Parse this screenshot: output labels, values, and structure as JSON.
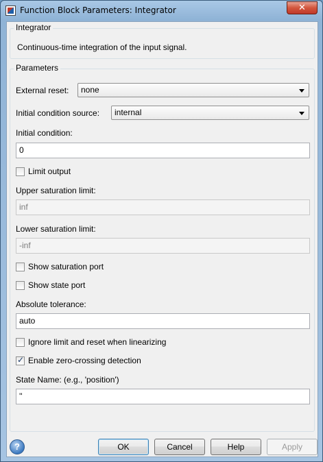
{
  "window": {
    "title": "Function Block Parameters: Integrator",
    "close_label": "✕"
  },
  "block": {
    "group_title": "Integrator",
    "description": "Continuous-time integration of the input signal."
  },
  "params": {
    "group_title": "Parameters",
    "external_reset": {
      "label": "External reset:",
      "value": "none"
    },
    "ic_source": {
      "label": "Initial condition source:",
      "value": "internal"
    },
    "initial_condition": {
      "label": "Initial condition:",
      "value": "0"
    },
    "limit_output": {
      "label": "Limit output",
      "checked": false
    },
    "upper_limit": {
      "label": "Upper saturation limit:",
      "value": "inf"
    },
    "lower_limit": {
      "label": "Lower saturation limit:",
      "value": "-inf"
    },
    "show_sat_port": {
      "label": "Show saturation port",
      "checked": false
    },
    "show_state_port": {
      "label": "Show state port",
      "checked": false
    },
    "abs_tol": {
      "label": "Absolute tolerance:",
      "value": "auto"
    },
    "ignore_limit": {
      "label": "Ignore limit and reset when linearizing",
      "checked": false
    },
    "zero_crossing": {
      "label": "Enable zero-crossing detection",
      "checked": true
    },
    "state_name": {
      "label": "State Name: (e.g., 'position')",
      "value": "''"
    }
  },
  "buttons": {
    "ok": "OK",
    "cancel": "Cancel",
    "help": "Help",
    "apply": "Apply",
    "help_icon": "?"
  }
}
